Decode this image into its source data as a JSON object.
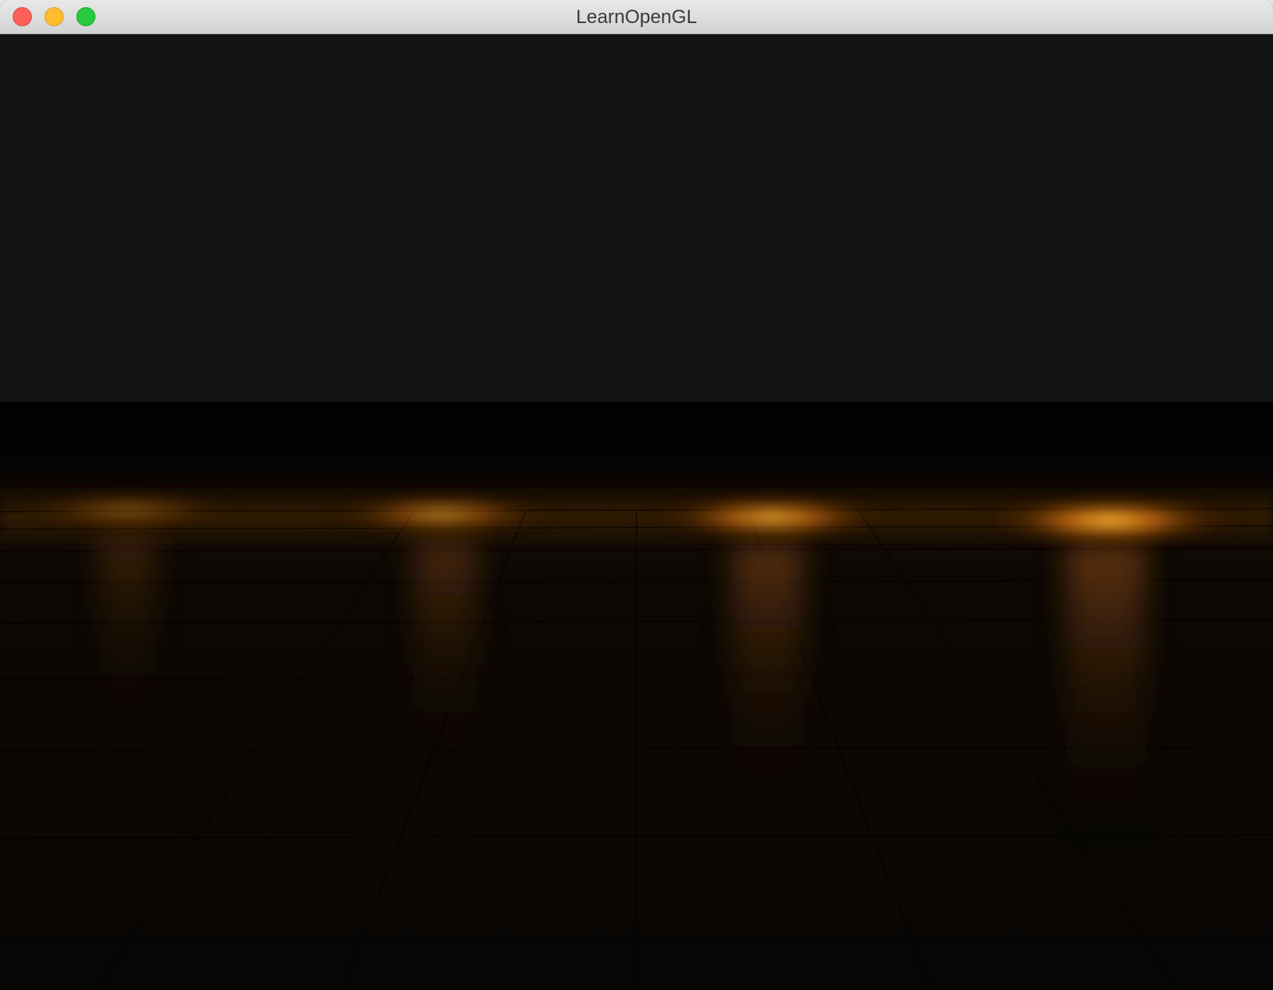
{
  "window": {
    "title": "LearnOpenGL",
    "controls": {
      "close": "close-button",
      "minimize": "minimize-button",
      "zoom": "zoom-button"
    }
  },
  "scene": {
    "background_color": "#141414",
    "floor_color": "#080604",
    "light_color": "#ffb030",
    "light_count": 4
  }
}
